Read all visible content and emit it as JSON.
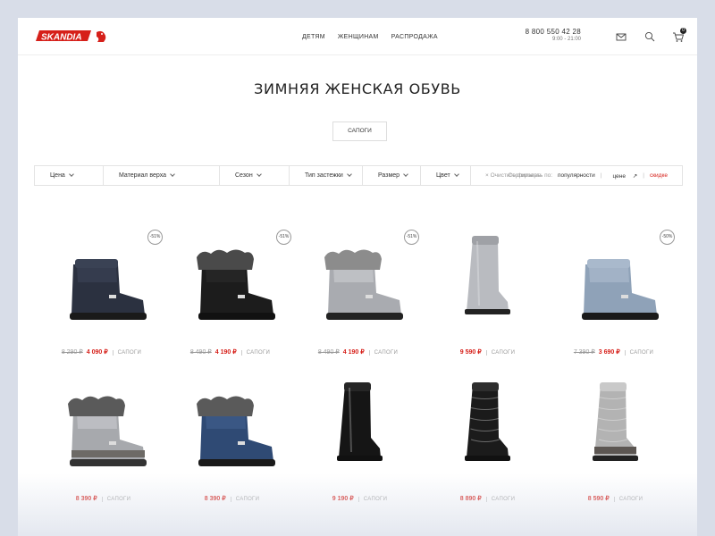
{
  "header": {
    "logo_text": "SKANDIA",
    "nav": [
      "ДЕТЯМ",
      "ЖЕНЩИНАМ",
      "РАСПРОДАЖА"
    ],
    "phone": "8 800 550 42 28",
    "hours": "9:00 - 21:00",
    "cart_count": "0"
  },
  "page_title": "ЗИМНЯЯ ЖЕНСКАЯ ОБУВЬ",
  "category_button": "САПОГИ",
  "filters": [
    "Цена",
    "Материал верха",
    "Сезон",
    "Тип застежки",
    "Размер",
    "Цвет"
  ],
  "clear_filters": "Очистить фильтры",
  "sort": {
    "label": "Сортировать по:",
    "options": [
      "популярности",
      "цене",
      "скидке"
    ]
  },
  "products": [
    {
      "discount": "-51%",
      "old_price": "8 290 ₽",
      "price": "4 090 ₽",
      "category": "САПОГИ",
      "color": "navy"
    },
    {
      "discount": "-51%",
      "old_price": "8 490 ₽",
      "price": "4 190 ₽",
      "category": "САПОГИ",
      "color": "black-fur"
    },
    {
      "discount": "-51%",
      "old_price": "8 490 ₽",
      "price": "4 190 ₽",
      "category": "САПОГИ",
      "color": "silver-fur"
    },
    {
      "discount": "",
      "old_price": "",
      "price": "9 590 ₽",
      "category": "САПОГИ",
      "color": "silver-tall"
    },
    {
      "discount": "-50%",
      "old_price": "7 390 ₽",
      "price": "3 690 ₽",
      "category": "САПОГИ",
      "color": "blue-grey"
    },
    {
      "discount": "",
      "old_price": "",
      "price": "8 390 ₽",
      "category": "САПОГИ",
      "color": "silver-grey-fur"
    },
    {
      "discount": "",
      "old_price": "",
      "price": "8 390 ₽",
      "category": "САПОГИ",
      "color": "blue-fur"
    },
    {
      "discount": "",
      "old_price": "",
      "price": "9 190 ₽",
      "category": "САПОГИ",
      "color": "black-tall"
    },
    {
      "discount": "",
      "old_price": "",
      "price": "8 890 ₽",
      "category": "САПОГИ",
      "color": "black-puffer"
    },
    {
      "discount": "",
      "old_price": "",
      "price": "8 590 ₽",
      "category": "САПОГИ",
      "color": "grey-puffer"
    }
  ],
  "colors": {
    "accent": "#d6201a",
    "text": "#222222",
    "muted": "#999999"
  },
  "icons": [
    "mail-icon",
    "search-icon",
    "cart-icon"
  ]
}
